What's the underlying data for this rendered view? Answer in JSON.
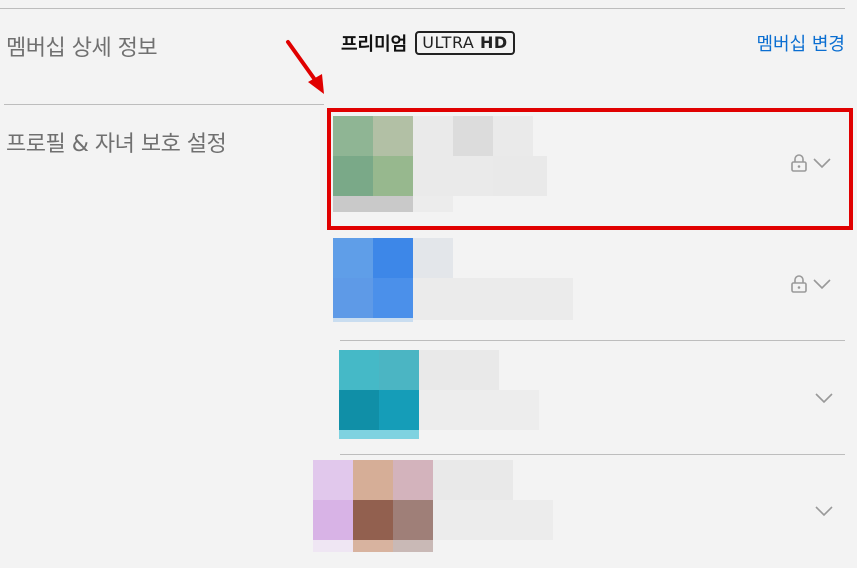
{
  "membership": {
    "section_label": "멤버십 상세 정보",
    "plan_name": "프리미엄",
    "plan_badge_thin": "ULTRA",
    "plan_badge_bold": "HD",
    "change_link": "멤버십 변경"
  },
  "profiles_section": {
    "section_label": "프로필 & 자녀 보호 설정"
  },
  "profiles": [
    {
      "locked": true,
      "colors": [
        "#8fb594",
        "#b2c0a5",
        "#7aa988",
        "#97b88e"
      ],
      "bar": "#c9c9c9"
    },
    {
      "locked": true,
      "colors": [
        "#5f9ee8",
        "#3d87e8",
        "#5e9ae7",
        "#4b90ea"
      ],
      "bar": "#c9ddf0"
    },
    {
      "locked": false,
      "colors": [
        "#45b9c7",
        "#4bb5c3",
        "#108fa7",
        "#159db8"
      ],
      "bar": "#7fd2e0"
    },
    {
      "locked": false,
      "colors": [
        "#e1c8ec",
        "#d6ae97",
        "#d8b3e6",
        "#92604f"
      ],
      "bar": "#e7ddd2"
    }
  ],
  "icons": {
    "lock": "lock-icon",
    "chevron": "chevron-down-icon",
    "arrow": "arrow-annotation"
  },
  "colors": {
    "link": "#0a6ed1",
    "highlight": "#e00000"
  }
}
